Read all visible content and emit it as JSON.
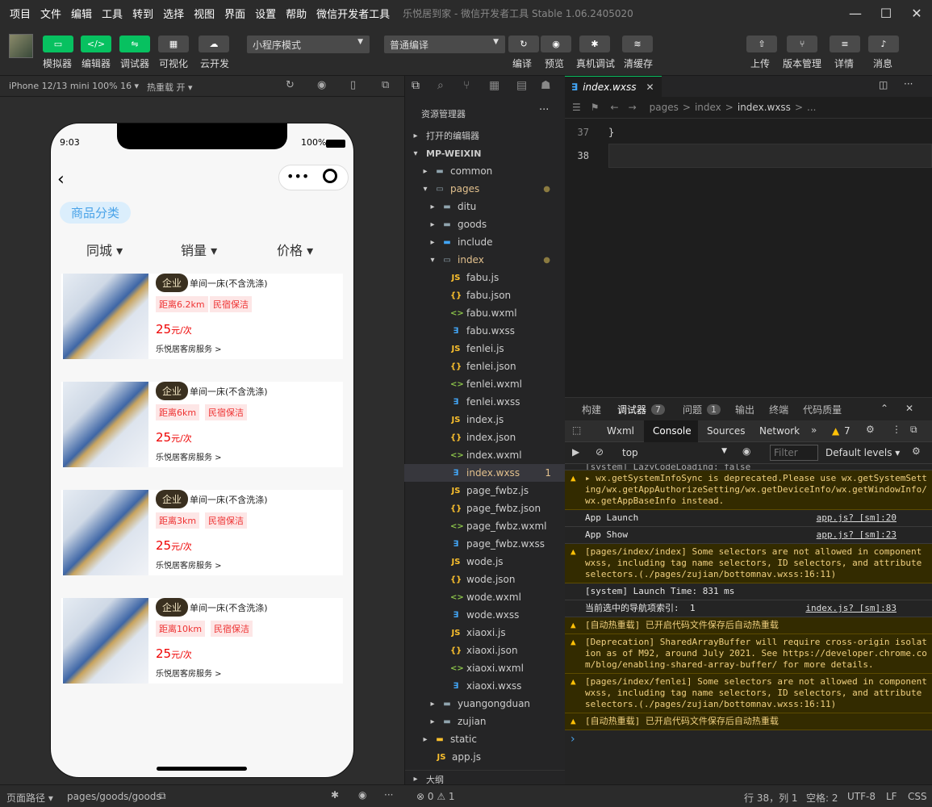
{
  "menu": [
    "项目",
    "文件",
    "编辑",
    "工具",
    "转到",
    "选择",
    "视图",
    "界面",
    "设置",
    "帮助",
    "微信开发者工具"
  ],
  "window_title": "乐悦居到家 - 微信开发者工具 Stable 1.06.2405020",
  "toolbar": {
    "left": [
      "模拟器",
      "编辑器",
      "调试器",
      "可视化",
      "云开发"
    ],
    "mode": "小程序模式",
    "compile": "普通编译",
    "mid": [
      "编译",
      "预览",
      "真机调试",
      "清缓存"
    ],
    "right": [
      "上传",
      "版本管理",
      "详情",
      "消息"
    ]
  },
  "sim_header": {
    "device": "iPhone 12/13 mini 100% 16 ▾",
    "hotreload": "热重载 开 ▾"
  },
  "phone": {
    "time": "9:03",
    "battery": "100%",
    "category": "商品分类",
    "filters": [
      "同城 ▾",
      "销量 ▾",
      "价格 ▾"
    ],
    "cards": [
      {
        "badge": "企业",
        "title": "单间一床(不含洗涤)",
        "distance": "距离6.2km",
        "tag": "民宿保洁",
        "price": "25",
        "unit": "元/次",
        "service": "乐悦居客房服务 >"
      },
      {
        "badge": "企业",
        "title": "单间一床(不含洗涤)",
        "distance": "距离6km",
        "tag": "民宿保洁",
        "price": "25",
        "unit": "元/次",
        "service": "乐悦居客房服务 >"
      },
      {
        "badge": "企业",
        "title": "单间一床(不含洗涤)",
        "distance": "距离3km",
        "tag": "民宿保洁",
        "price": "25",
        "unit": "元/次",
        "service": "乐悦居客房服务 >"
      },
      {
        "badge": "企业",
        "title": "单间一床(不含洗涤)",
        "distance": "距离10km",
        "tag": "民宿保洁",
        "price": "25",
        "unit": "元/次",
        "service": "乐悦居客房服务 >"
      }
    ]
  },
  "explorer": {
    "title": "资源管理器",
    "open_editors": "打开的编辑器",
    "project": "MP-WEIXIN",
    "tree": [
      {
        "name": "common",
        "d": 1,
        "t": "folder",
        "a": "▸"
      },
      {
        "name": "pages",
        "d": 1,
        "t": "folder-o",
        "a": "▾",
        "c": "#e2c08d",
        "dot": true
      },
      {
        "name": "ditu",
        "d": 2,
        "t": "folder",
        "a": "▸"
      },
      {
        "name": "goods",
        "d": 2,
        "t": "folder",
        "a": "▸"
      },
      {
        "name": "include",
        "d": 2,
        "t": "folder-b",
        "a": "▸"
      },
      {
        "name": "index",
        "d": 2,
        "t": "folder-o",
        "a": "▾",
        "c": "#e2c08d",
        "dot": true
      },
      {
        "name": "fabu.js",
        "d": 3,
        "t": "js"
      },
      {
        "name": "fabu.json",
        "d": 3,
        "t": "json"
      },
      {
        "name": "fabu.wxml",
        "d": 3,
        "t": "wxml"
      },
      {
        "name": "fabu.wxss",
        "d": 3,
        "t": "wxss"
      },
      {
        "name": "fenlei.js",
        "d": 3,
        "t": "js"
      },
      {
        "name": "fenlei.json",
        "d": 3,
        "t": "json"
      },
      {
        "name": "fenlei.wxml",
        "d": 3,
        "t": "wxml"
      },
      {
        "name": "fenlei.wxss",
        "d": 3,
        "t": "wxss"
      },
      {
        "name": "index.js",
        "d": 3,
        "t": "js"
      },
      {
        "name": "index.json",
        "d": 3,
        "t": "json"
      },
      {
        "name": "index.wxml",
        "d": 3,
        "t": "wxml"
      },
      {
        "name": "index.wxss",
        "d": 3,
        "t": "wxss",
        "c": "#e2c08d",
        "sel": true,
        "count": "1"
      },
      {
        "name": "page_fwbz.js",
        "d": 3,
        "t": "js"
      },
      {
        "name": "page_fwbz.json",
        "d": 3,
        "t": "json"
      },
      {
        "name": "page_fwbz.wxml",
        "d": 3,
        "t": "wxml"
      },
      {
        "name": "page_fwbz.wxss",
        "d": 3,
        "t": "wxss"
      },
      {
        "name": "wode.js",
        "d": 3,
        "t": "js"
      },
      {
        "name": "wode.json",
        "d": 3,
        "t": "json"
      },
      {
        "name": "wode.wxml",
        "d": 3,
        "t": "wxml"
      },
      {
        "name": "wode.wxss",
        "d": 3,
        "t": "wxss"
      },
      {
        "name": "xiaoxi.js",
        "d": 3,
        "t": "js"
      },
      {
        "name": "xiaoxi.json",
        "d": 3,
        "t": "json"
      },
      {
        "name": "xiaoxi.wxml",
        "d": 3,
        "t": "wxml"
      },
      {
        "name": "xiaoxi.wxss",
        "d": 3,
        "t": "wxss"
      },
      {
        "name": "yuangongduan",
        "d": 2,
        "t": "folder",
        "a": "▸"
      },
      {
        "name": "zujian",
        "d": 2,
        "t": "folder",
        "a": "▸"
      },
      {
        "name": "static",
        "d": 1,
        "t": "folder-y",
        "a": "▸"
      },
      {
        "name": "app.js",
        "d": 1,
        "t": "js"
      }
    ],
    "outline": "大纲"
  },
  "editor": {
    "tab": "index.wxss",
    "breadcrumb": [
      "pages",
      ">",
      "index",
      ">",
      "index.wxss",
      ">",
      "..."
    ],
    "lines": [
      {
        "n": "37",
        "code": "}"
      },
      {
        "n": "38",
        "code": ""
      }
    ]
  },
  "devtools": {
    "tabs": [
      "构建",
      "调试器",
      "问题",
      "输出",
      "终端",
      "代码质量"
    ],
    "debug_count": "7",
    "issue_count": "1",
    "subtabs": [
      "Wxml",
      "Console",
      "Sources",
      "Network"
    ],
    "warn_count": "7",
    "context": "top",
    "filter_placeholder": "Filter",
    "levels": "Default levels ▾",
    "truncated": "[system] LazyCodeLoading: false",
    "logs": [
      {
        "w": true,
        "text": "▸ wx.getSystemInfoSync is deprecated.Please use wx.getSystemSetting/wx.getAppAuthorizeSetting/wx.getDeviceInfo/wx.getWindowInfo/wx.getAppBaseInfo instead.",
        "src": ""
      },
      {
        "w": false,
        "text": "App Launch",
        "src": "app.js? [sm]:20"
      },
      {
        "w": false,
        "text": "App Show",
        "src": "app.js? [sm]:23"
      },
      {
        "w": true,
        "text": "[pages/index/index] Some selectors are not allowed in component wxss, including tag name selectors, ID selectors, and attribute selectors.(./pages/zujian/bottomnav.wxss:16:11)",
        "src": ""
      },
      {
        "w": false,
        "text": "[system] Launch Time: 831 ms",
        "src": ""
      },
      {
        "w": false,
        "text": "当前选中的导航项索引:  1",
        "src": "index.js? [sm]:83"
      },
      {
        "w": true,
        "text": "[自动热重载] 已开启代码文件保存后自动热重载",
        "src": ""
      },
      {
        "w": true,
        "text": "[Deprecation] SharedArrayBuffer will require cross-origin isolation as of M92, around July 2021. See https://developer.chrome.com/blog/enabling-shared-array-buffer/ for more details.",
        "src": ""
      },
      {
        "w": true,
        "text": "[pages/index/fenlei] Some selectors are not allowed in component wxss, including tag name selectors, ID selectors, and attribute selectors.(./pages/zujian/bottomnav.wxss:16:11)",
        "src": ""
      },
      {
        "w": true,
        "text": "[自动热重载] 已开启代码文件保存后自动热重载",
        "src": ""
      }
    ],
    "prompt": "›"
  },
  "status": {
    "page_path_label": "页面路径 ▾",
    "page_path": "pages/goods/goods",
    "problems": "⊗ 0 ⚠ 1",
    "line_col": "行 38，列 1",
    "spaces": "空格: 2",
    "encoding": "UTF-8",
    "eol": "LF",
    "lang": "CSS"
  }
}
